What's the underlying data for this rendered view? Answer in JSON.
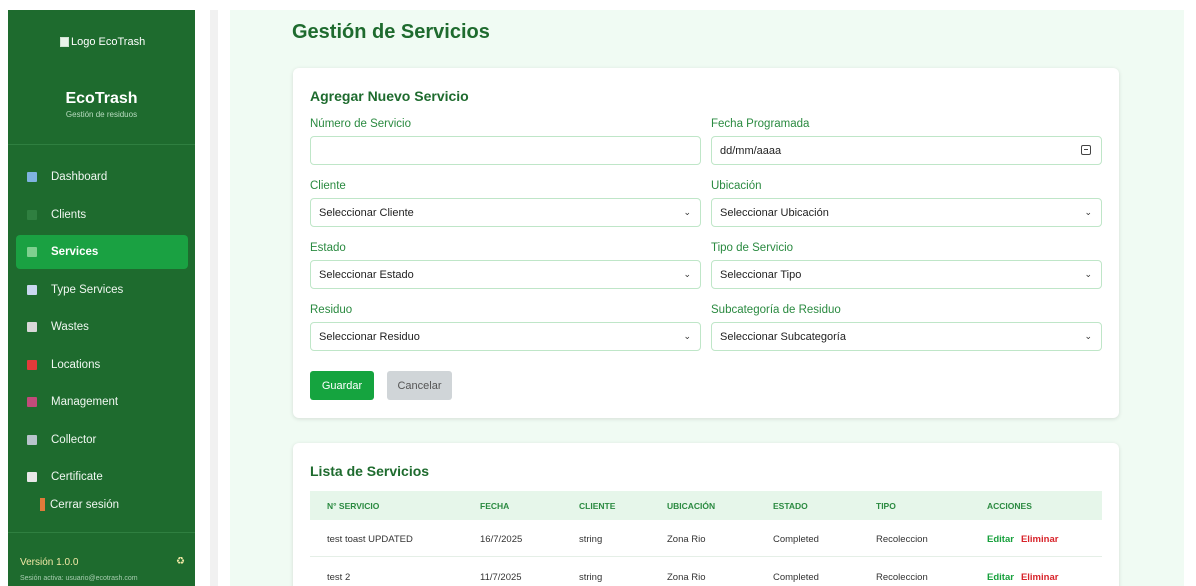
{
  "sidebar": {
    "logo_alt": "Logo EcoTrash",
    "brand": "EcoTrash",
    "brand_subtitle": "Gestión de residuos",
    "items": [
      {
        "label": "Dashboard",
        "icon": "bar-chart-icon",
        "color": "#7fb3e0"
      },
      {
        "label": "Clients",
        "icon": "users-icon",
        "color": "#2f7f40"
      },
      {
        "label": "Services",
        "icon": "recycle-icon",
        "color": "#7fd08f"
      },
      {
        "label": "Type Services",
        "icon": "chart-icon",
        "color": "#c9d8f0"
      },
      {
        "label": "Wastes",
        "icon": "trash-icon",
        "color": "#d8d8d8"
      },
      {
        "label": "Locations",
        "icon": "flag-icon",
        "color": "#e23a3a"
      },
      {
        "label": "Management",
        "icon": "card-icon",
        "color": "#c24b7a"
      },
      {
        "label": "Collector",
        "icon": "truck-icon",
        "color": "#b8c4cc"
      },
      {
        "label": "Certificate",
        "icon": "document-icon",
        "color": "#e8e8e8"
      }
    ],
    "active_index": 2,
    "logout": "Cerrar sesión",
    "version": "Versión 1.0.0",
    "session": "Sesión activa: usuario@ecotrash.com"
  },
  "page": {
    "title": "Gestión de Servicios"
  },
  "form": {
    "title": "Agregar Nuevo Servicio",
    "fields": {
      "numero": {
        "label": "Número de Servicio",
        "value": ""
      },
      "fecha": {
        "label": "Fecha Programada",
        "value": "dd/mm/aaaa"
      },
      "cliente": {
        "label": "Cliente",
        "value": "Seleccionar Cliente"
      },
      "ubicacion": {
        "label": "Ubicación",
        "value": "Seleccionar Ubicación"
      },
      "estado": {
        "label": "Estado",
        "value": "Seleccionar Estado"
      },
      "tipo": {
        "label": "Tipo de Servicio",
        "value": "Seleccionar Tipo"
      },
      "residuo": {
        "label": "Residuo",
        "value": "Seleccionar Residuo"
      },
      "subcategoria": {
        "label": "Subcategoría de Residuo",
        "value": "Seleccionar Subcategoría"
      }
    },
    "save_label": "Guardar",
    "cancel_label": "Cancelar"
  },
  "list": {
    "title": "Lista de Servicios",
    "columns": [
      "N° SERVICIO",
      "FECHA",
      "CLIENTE",
      "UBICACIÓN",
      "ESTADO",
      "TIPO",
      "ACCIONES"
    ],
    "rows": [
      {
        "numero": "test toast UPDATED",
        "fecha": "16/7/2025",
        "cliente": "string",
        "ubicacion": "Zona Rio",
        "estado": "Completed",
        "tipo": "Recoleccion"
      },
      {
        "numero": "test 2",
        "fecha": "11/7/2025",
        "cliente": "string",
        "ubicacion": "Zona Rio",
        "estado": "Completed",
        "tipo": "Recoleccion"
      }
    ],
    "edit_label": "Editar",
    "delete_label": "Eliminar"
  },
  "colors": {
    "sidebar_bg": "#1e6b2e",
    "active_item": "#1aa142",
    "primary": "#15a43f",
    "danger": "#d8232a",
    "heading": "#1e6b2e"
  }
}
